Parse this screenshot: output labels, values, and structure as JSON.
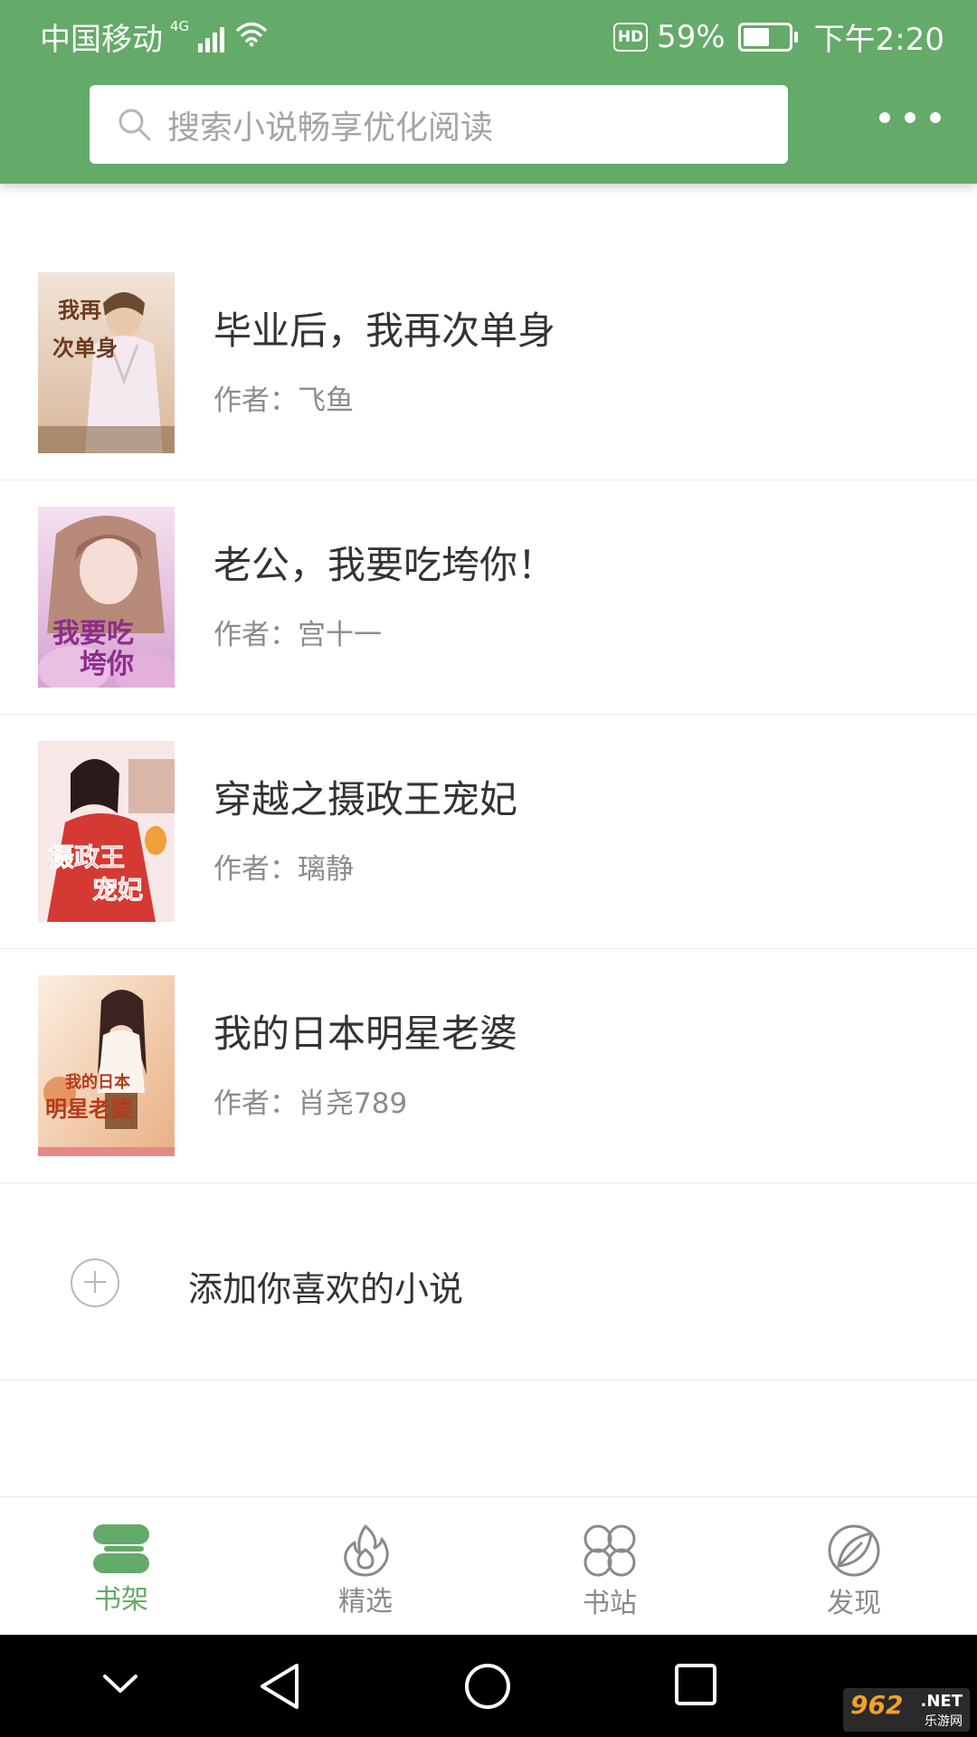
{
  "status_bar": {
    "carrier": "中国移动",
    "network": "4G",
    "hd": "HD",
    "battery": "59%",
    "battery_level": 0.59,
    "time": "下午2:20"
  },
  "search": {
    "placeholder": "搜索小说畅享优化阅读"
  },
  "books": [
    {
      "title": "毕业后，我再次单身",
      "author": "作者：飞鱼",
      "cover_text": [
        "我再",
        "次单身"
      ],
      "cover_colors": [
        "#d9b79a",
        "#f1e4d8",
        "#6c5540"
      ]
    },
    {
      "title": "老公，我要吃垮你！",
      "author": "作者：宫十一",
      "cover_text": [
        "我要吃",
        "垮你"
      ],
      "cover_colors": [
        "#d6a2d2",
        "#f4e1ef",
        "#8e2c8c"
      ]
    },
    {
      "title": "穿越之摄政王宠妃",
      "author": "作者：璃静",
      "cover_text": [
        "摄政王",
        "宠妃"
      ],
      "cover_colors": [
        "#d43a33",
        "#f5e8e6",
        "#b31d1d"
      ]
    },
    {
      "title": "我的日本明星老婆",
      "author": "作者：肖尧789",
      "cover_text": [
        "我的日本",
        "明星老婆"
      ],
      "cover_colors": [
        "#e9b083",
        "#fbefe1",
        "#b63a1a"
      ]
    }
  ],
  "add_book": {
    "label": "添加你喜欢的小说"
  },
  "tabs": [
    {
      "label": "书架",
      "icon": "bookshelf-icon",
      "active": true
    },
    {
      "label": "精选",
      "icon": "flame-icon",
      "active": false
    },
    {
      "label": "书站",
      "icon": "grid-circles-icon",
      "active": false
    },
    {
      "label": "发现",
      "icon": "leaf-icon",
      "active": false
    }
  ],
  "watermark": {
    "brand": "962",
    "suffix": ".NET",
    "sub": "乐游网"
  },
  "colors": {
    "primary": "#64aa68",
    "text": "#333333",
    "muted": "#8c8c8c"
  }
}
